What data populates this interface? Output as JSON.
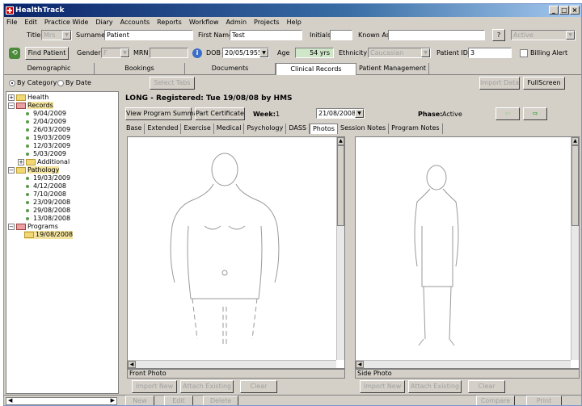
{
  "window": {
    "title": "HealthTrack",
    "buttons": [
      "_",
      "□",
      "×"
    ]
  },
  "menu": [
    "File",
    "Edit",
    "Practice Wide",
    "Diary",
    "Accounts",
    "Reports",
    "Workflow",
    "Admin",
    "Projects",
    "Help"
  ],
  "patient": {
    "title_label": "Title",
    "title_value": "Mrs",
    "surname_label": "Surname",
    "surname_value": "Patient",
    "firstname_label": "First Name",
    "firstname_value": "Test",
    "initials_label": "Initials",
    "initials_value": "",
    "knownas_label": "Known As",
    "knownas_value": "",
    "help_btn": "?",
    "status_value": "Active",
    "find_btn": "Find Patient",
    "gender_label": "Gender",
    "gender_value": "F",
    "mrn_label": "MRN",
    "mrn_value": "",
    "dob_label": "DOB",
    "dob_value": "20/05/1955",
    "age_label": "Age",
    "age_value": "54 yrs",
    "ethnicity_label": "Ethnicity",
    "ethnicity_value": "Caucasian",
    "patientid_label": "Patient ID",
    "patientid_value": "3",
    "billing_label": "Billing Alert"
  },
  "tabs": [
    "Demographic",
    "Bookings",
    "Documents",
    "Clinical Records",
    "Patient Management"
  ],
  "active_tab": "Clinical Records",
  "sort": {
    "by_category": "By Category",
    "by_date": "By Date",
    "select_tabs": "Select Tabs",
    "import_data": "Import Data",
    "fullscreen": "FullScreen"
  },
  "tree": {
    "health": "Health",
    "records": "Records",
    "record_dates": [
      "9/04/2009",
      "2/04/2009",
      "26/03/2009",
      "19/03/2009",
      "12/03/2009",
      "5/03/2009"
    ],
    "additional": "Additional",
    "pathology": "Pathology",
    "pathology_dates": [
      "19/03/2009",
      "4/12/2008",
      "7/10/2008",
      "23/09/2008",
      "29/08/2008",
      "13/08/2008"
    ],
    "programs": "Programs",
    "program_dates": [
      "19/08/2008"
    ]
  },
  "program": {
    "header": "LONG - Registered: Tue 19/08/08 by HMS",
    "view_summary": "View Program Summary",
    "part_cert": "Part Certificate",
    "week_label": "Week:",
    "week_value": "1",
    "date_value": "21/08/2008",
    "phase_label": "Phase:",
    "phase_value": "Active",
    "subtabs": [
      "Base",
      "Extended",
      "Exercise",
      "Medical",
      "Psychology",
      "DASS",
      "Photos",
      "Session Notes",
      "Program Notes"
    ],
    "active_subtab": "Photos"
  },
  "photos": {
    "front_caption": "Front Photo",
    "side_caption": "Side Photo",
    "import_new": "Import New",
    "attach_existing": "Attach Existing",
    "clear": "Clear"
  },
  "bottom": {
    "new": "New",
    "edit": "Edit",
    "delete": "Delete",
    "compare": "Compare",
    "print": "Print"
  },
  "colors": {
    "title_bar": "#0a246a",
    "arrow_green": "#4caf50",
    "folder": "#f2d874"
  }
}
